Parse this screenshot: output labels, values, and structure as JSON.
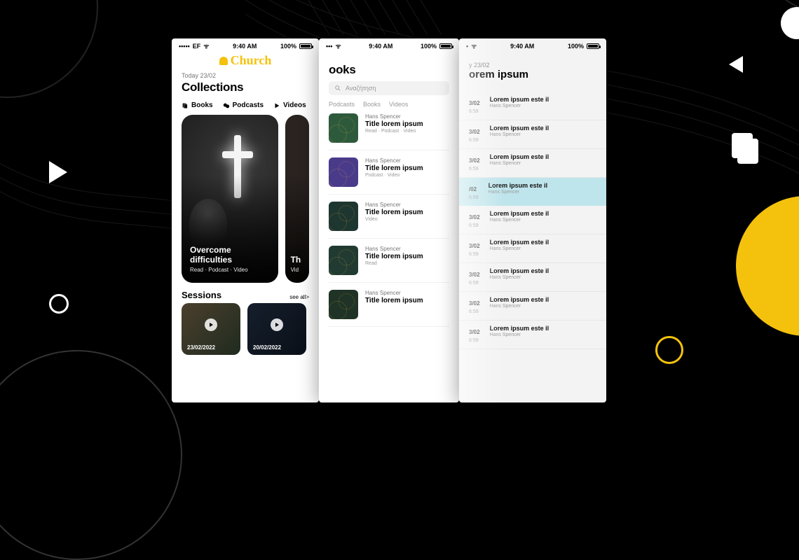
{
  "status": {
    "carrier": "EF",
    "time": "9:40 AM",
    "battery": "100%"
  },
  "screen1": {
    "logo": "Church",
    "date": "Today 23/02",
    "title": "Collections",
    "tabs": {
      "books": "Books",
      "podcasts": "Podcasts",
      "videos": "Videos"
    },
    "hero": {
      "title": "Overcome difficulties",
      "meta": "Read · Podcast · Video"
    },
    "hero2": {
      "titlePrefix": "Th",
      "metaPrefix": "Vid"
    },
    "sessionsHeading": "Sessions",
    "seeAll": "see all>",
    "sessions": [
      {
        "date": "23/02/2022"
      },
      {
        "date": "20/02/2022"
      }
    ]
  },
  "screen2": {
    "titlePrefix": "ooks",
    "searchPlaceholder": "Αναζήτηση",
    "subtabs": {
      "podcasts": "Podcasts",
      "books": "Books",
      "videos": "Videos"
    },
    "items": [
      {
        "author": "Hans Spencer",
        "title": "Title lorem ipsum",
        "tags": "Read · Podcast · Video"
      },
      {
        "author": "Hans Spencer",
        "title": "Title lorem ipsum",
        "tags": "Podcast · Video"
      },
      {
        "author": "Hans Spencer",
        "title": "Title lorem ipsum",
        "tags": "Video"
      },
      {
        "author": "Hans Spencer",
        "title": "Title lorem ipsum",
        "tags": "Read"
      },
      {
        "author": "Hans Spencer",
        "title": "Title lorem ipsum",
        "tags": ""
      }
    ]
  },
  "screen3": {
    "datePrefix": "y 23/02",
    "titlePrefix": "orem ipsum",
    "rows": [
      {
        "d1": "3/02",
        "d2": "6:59",
        "title": "Lorem ipsum este il",
        "author": "Hans Spencer",
        "hl": false
      },
      {
        "d1": "3/02",
        "d2": "6:59",
        "title": "Lorem ipsum este il",
        "author": "Hans Spencer",
        "hl": false
      },
      {
        "d1": "3/02",
        "d2": "6:59",
        "title": "Lorem ipsum este il",
        "author": "Hans Spencer",
        "hl": false
      },
      {
        "d1": "/02",
        "d2": "6:59",
        "title": "Lorem ipsum este il",
        "author": "Hans Spencer",
        "hl": true
      },
      {
        "d1": "3/02",
        "d2": "6:59",
        "title": "Lorem ipsum este il",
        "author": "Hans Spencer",
        "hl": false
      },
      {
        "d1": "3/02",
        "d2": "6:59",
        "title": "Lorem ipsum este il",
        "author": "Hans Spencer",
        "hl": false
      },
      {
        "d1": "3/02",
        "d2": "6:59",
        "title": "Lorem ipsum este il",
        "author": "Hans Spencer",
        "hl": false
      },
      {
        "d1": "3/02",
        "d2": "6:59",
        "title": "Lorem ipsum este il",
        "author": "Hans Spencer",
        "hl": false
      },
      {
        "d1": "3/02",
        "d2": "6:59",
        "title": "Lorem ipsum este il",
        "author": "Hans Spencer",
        "hl": false
      }
    ]
  }
}
